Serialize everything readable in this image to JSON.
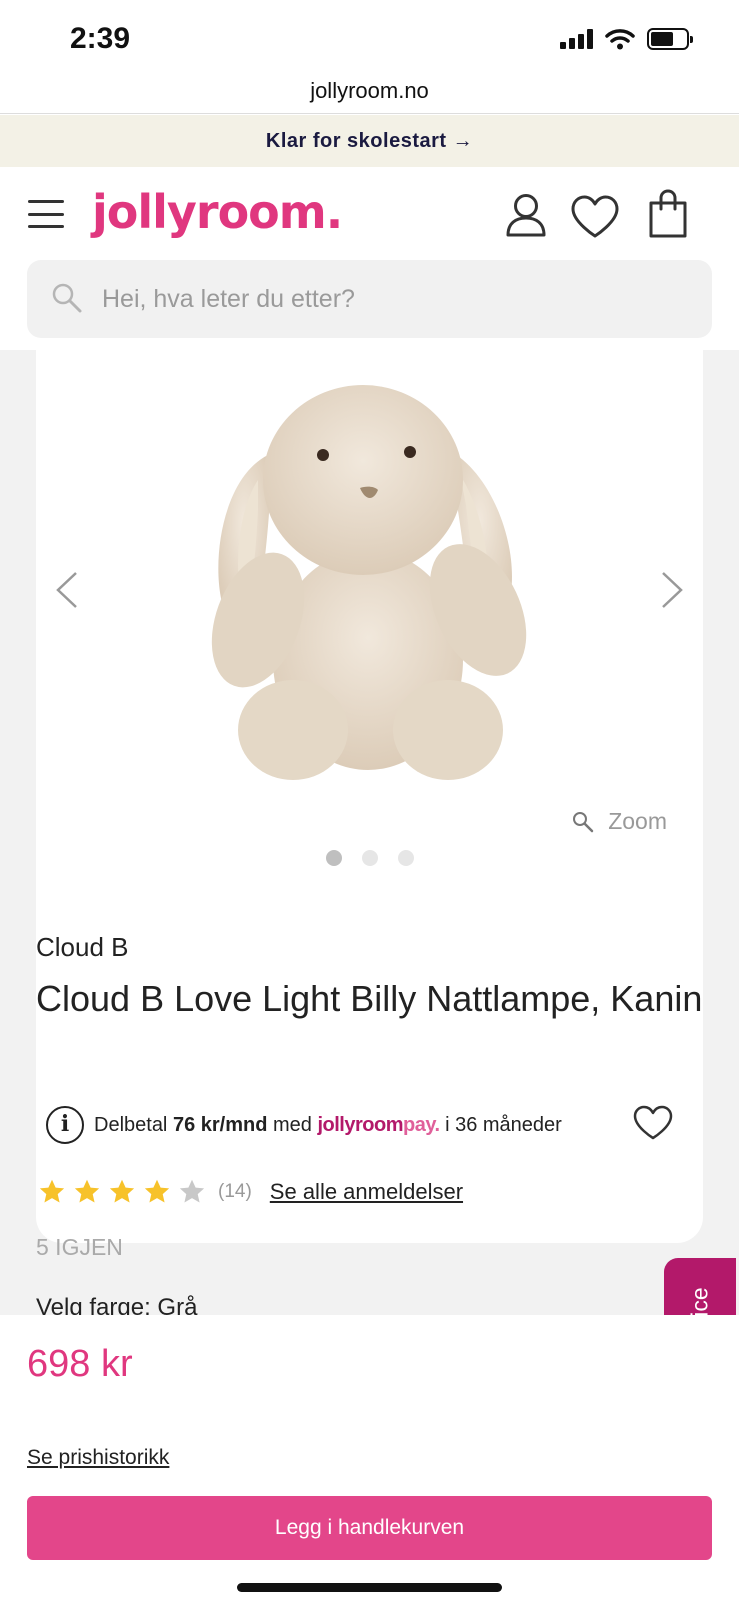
{
  "status_bar": {
    "time": "2:39"
  },
  "browser": {
    "url": "jollyroom.no"
  },
  "promo": {
    "text": "Klar for skolestart →"
  },
  "header": {
    "logo": "jollyroom.",
    "search_placeholder": "Hei, hva leter du etter?"
  },
  "gallery": {
    "zoom_label": "Zoom",
    "image_count": 3,
    "active_index": 0
  },
  "product": {
    "brand": "Cloud B",
    "title": "Cloud B Love Light Billy Nattlampe, Kanin",
    "installment": {
      "prefix": "Delbetal",
      "amount": "76 kr/mnd",
      "med": "med",
      "logo_main": "jollyroom",
      "logo_suffix": "pay.",
      "suffix": "i 36 måneder"
    },
    "rating": {
      "stars": 4,
      "max": 5,
      "count_text": "(14)"
    },
    "reviews_link": "Se alle anmeldelser",
    "stock": "5 IGJEN",
    "color_label": "Velg farge: Grå"
  },
  "customer_service": "Kundeservice",
  "purchase": {
    "price": "698 kr",
    "price_history": "Se prishistorikk",
    "add_to_cart": "Legg i handlekurven"
  },
  "colors": {
    "brand_pink": "#e0377f",
    "button_pink": "#e3468a",
    "tab_magenta": "#b3196a",
    "star_gold": "#f7c22a"
  }
}
